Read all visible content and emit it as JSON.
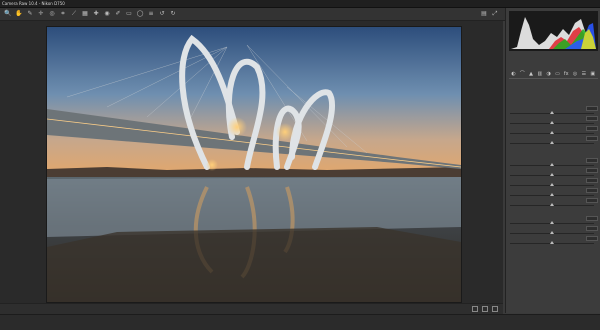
{
  "window": {
    "title": "Camera Raw 10.4 - Nikon D750"
  },
  "toolbar": {
    "tools": [
      {
        "name": "zoom-icon",
        "glyph": "🔍"
      },
      {
        "name": "hand-icon",
        "glyph": "✋"
      },
      {
        "name": "white-balance-icon",
        "glyph": "✎"
      },
      {
        "name": "color-sampler-icon",
        "glyph": "✛"
      },
      {
        "name": "target-adjust-icon",
        "glyph": "◎"
      },
      {
        "name": "crop-icon",
        "glyph": "⌗"
      },
      {
        "name": "straighten-icon",
        "glyph": "⟋"
      },
      {
        "name": "transform-icon",
        "glyph": "▦"
      },
      {
        "name": "spot-removal-icon",
        "glyph": "✚"
      },
      {
        "name": "red-eye-icon",
        "glyph": "◉"
      },
      {
        "name": "adjustment-brush-icon",
        "glyph": "✐"
      },
      {
        "name": "graduated-filter-icon",
        "glyph": "▭"
      },
      {
        "name": "radial-filter-icon",
        "glyph": "◯"
      },
      {
        "name": "preferences-icon",
        "glyph": "≡"
      },
      {
        "name": "rotate-ccw-icon",
        "glyph": "↺"
      },
      {
        "name": "rotate-cw-icon",
        "glyph": "↻"
      }
    ],
    "right_tools": [
      {
        "name": "filmstrip-icon",
        "glyph": "▤"
      },
      {
        "name": "fullscreen-icon",
        "glyph": "⤢"
      }
    ]
  },
  "status": {
    "zoom": "",
    "filename": ""
  },
  "panel": {
    "camera_info": {
      "f": "",
      "shutter": "",
      "iso": "",
      "lens": ""
    },
    "tabs": [
      "basic-tab-icon",
      "tone-curve-tab-icon",
      "detail-tab-icon",
      "hsl-tab-icon",
      "split-toning-tab-icon",
      "lens-tab-icon",
      "effects-tab-icon",
      "calibration-tab-icon",
      "presets-tab-icon",
      "snapshots-tab-icon"
    ],
    "title": "",
    "white_balance": {
      "label": "",
      "value": ""
    },
    "sliders": [
      {
        "label": "",
        "value": "",
        "pos": 0.5
      },
      {
        "label": "",
        "value": "",
        "pos": 0.5
      },
      {
        "label": "",
        "value": "",
        "pos": 0.5
      },
      {
        "label": "",
        "value": "",
        "pos": 0.5
      },
      {
        "label": "",
        "value": "",
        "pos": 0.5
      },
      {
        "label": "",
        "value": "",
        "pos": 0.5
      },
      {
        "label": "",
        "value": "",
        "pos": 0.5
      },
      {
        "label": "",
        "value": "",
        "pos": 0.5
      },
      {
        "label": "",
        "value": "",
        "pos": 0.5
      },
      {
        "label": "",
        "value": "",
        "pos": 0.5
      },
      {
        "label": "",
        "value": "",
        "pos": 0.5
      },
      {
        "label": "",
        "value": "",
        "pos": 0.5
      }
    ]
  },
  "footer": {
    "save_label": "",
    "meta": "",
    "open_label": "",
    "cancel_label": ""
  },
  "colors": {
    "bg": "#3a3a3a",
    "panel": "#3c3c3c",
    "accent": "#9fb6d6"
  }
}
